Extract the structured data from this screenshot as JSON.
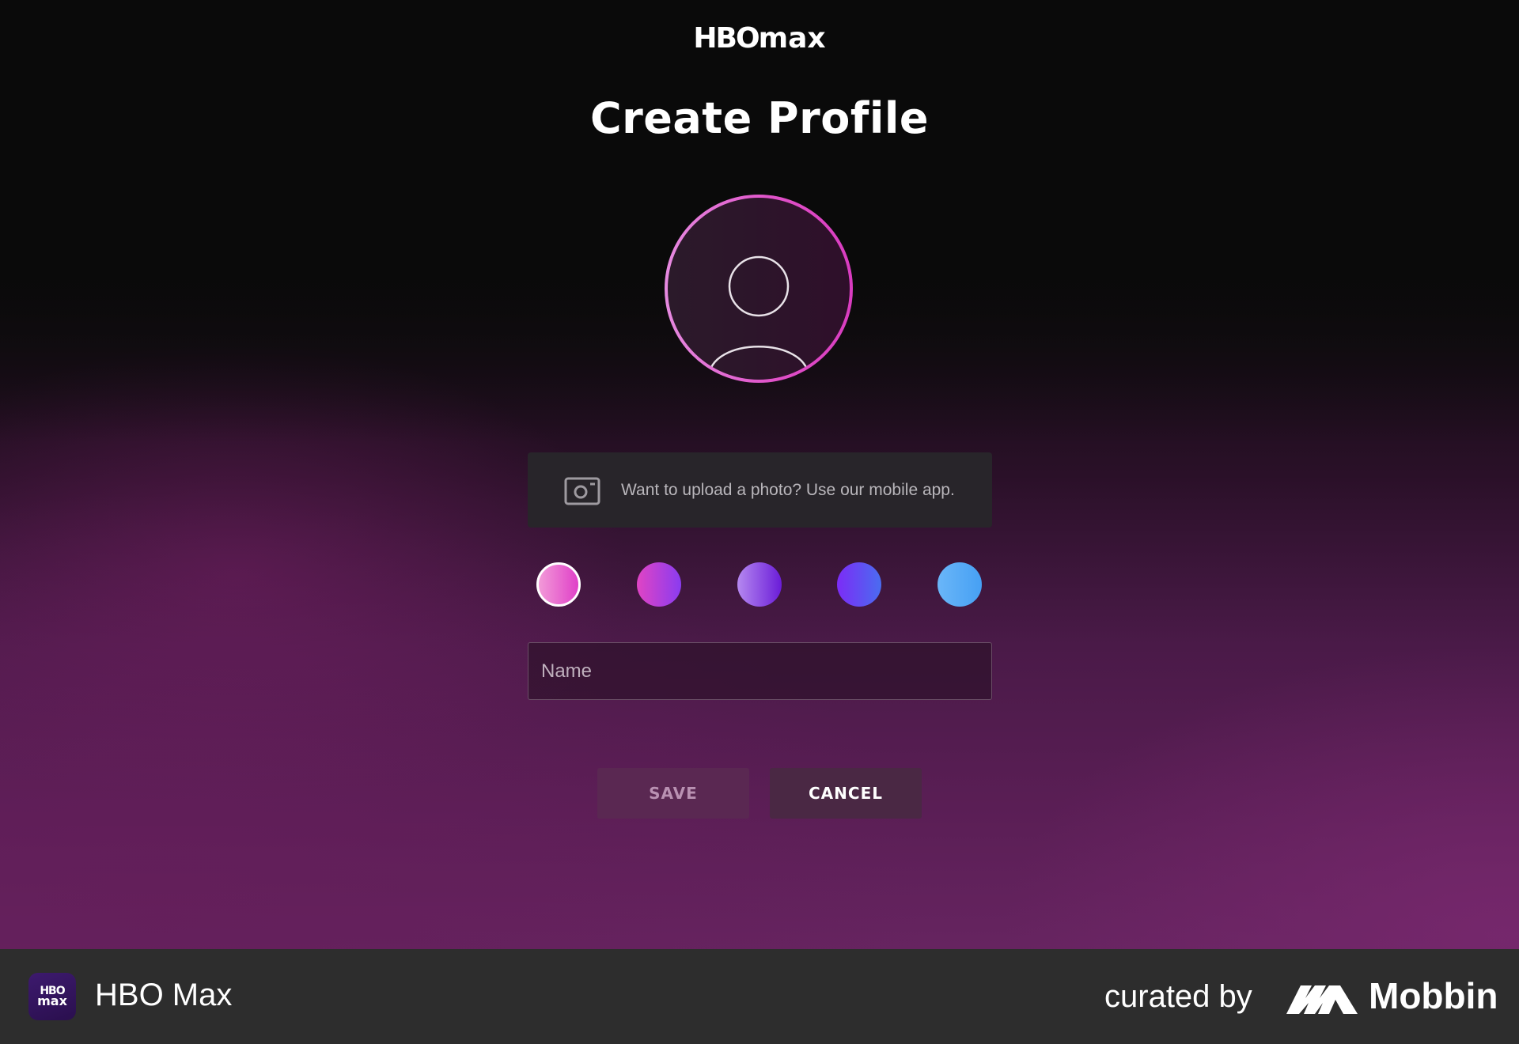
{
  "header": {
    "logo_hbo": "HBO",
    "logo_max": "max",
    "title": "Create Profile"
  },
  "avatar": {
    "icon": "default-user-silhouette-icon"
  },
  "upload_notice": {
    "icon": "camera-icon",
    "text": "Want to upload a photo? Use our mobile app."
  },
  "color_swatches": [
    {
      "name": "pink",
      "from": "#f29ad8",
      "to": "#e040c8",
      "selected": true
    },
    {
      "name": "magenta-violet",
      "from": "#e044c4",
      "to": "#8a3cf0",
      "selected": false
    },
    {
      "name": "lavender-purple",
      "from": "#b588f0",
      "to": "#6a1cd8",
      "selected": false
    },
    {
      "name": "violet-blue",
      "from": "#7c2cf6",
      "to": "#4a6cf0",
      "selected": false
    },
    {
      "name": "sky-blue",
      "from": "#6ab6f8",
      "to": "#46a0f4",
      "selected": false
    }
  ],
  "form": {
    "name_placeholder": "Name",
    "name_value": "",
    "save_label": "SAVE",
    "cancel_label": "CANCEL"
  },
  "footer": {
    "app_icon_line1": "HBO",
    "app_icon_line2": "max",
    "app_name": "HBO Max",
    "curated_by": "curated by",
    "brand": "Mobbin"
  }
}
